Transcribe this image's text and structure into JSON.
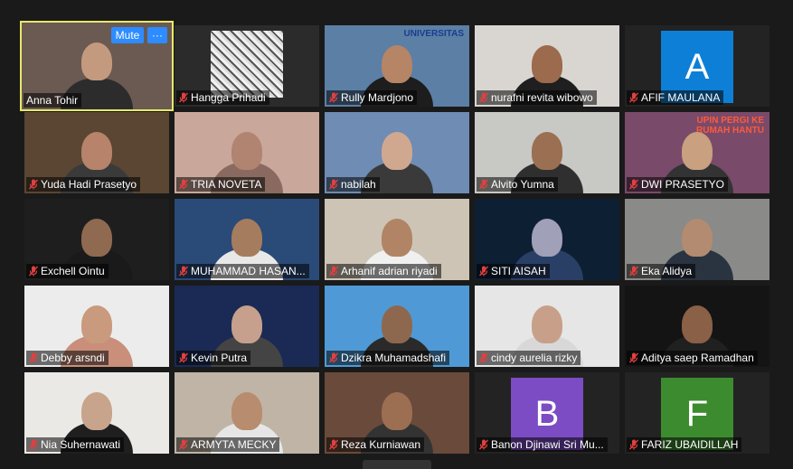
{
  "meeting": {
    "controls": {
      "mute_label": "Mute",
      "more_label": "···"
    },
    "participants": [
      {
        "name": "Anna Tohir",
        "muted": false,
        "active": true,
        "kind": "video",
        "bg": "#6b5a52",
        "skin": "#c49a7e",
        "cloth": "#2c2c2c"
      },
      {
        "name": "Hangga Prihadi",
        "muted": true,
        "kind": "image",
        "bg": "#2b2b2b",
        "picture": "#e8e8e8"
      },
      {
        "name": "Rully Mardjono",
        "muted": true,
        "kind": "video",
        "bg": "#5c7fa6",
        "skin": "#b58566",
        "cloth": "#1d1d1d",
        "banner": "UNIVERSITAS"
      },
      {
        "name": "nurafni revita wibowo",
        "muted": true,
        "kind": "video",
        "bg": "#d9d6d2",
        "skin": "#9c6a4d",
        "cloth": "#1f1f1f"
      },
      {
        "name": "AFIF MAULANA",
        "muted": true,
        "kind": "avatar",
        "letter": "A",
        "avatar_color": "#0e7fd6"
      },
      {
        "name": "Yuda Hadi Prasetyo",
        "muted": true,
        "kind": "video",
        "bg": "#5a4632",
        "skin": "#b7836a",
        "cloth": "#3a3a3a"
      },
      {
        "name": "TRIA NOVETA",
        "muted": true,
        "kind": "video",
        "bg": "#c9a79a",
        "skin": "#b08470",
        "cloth": "#8a6a60"
      },
      {
        "name": "nabilah",
        "muted": true,
        "kind": "video",
        "bg": "#6e8cb4",
        "skin": "#d0a890",
        "cloth": "#3a3a3a"
      },
      {
        "name": "Alvito Yumna",
        "muted": true,
        "kind": "video",
        "bg": "#c8c8c4",
        "skin": "#9b6f52",
        "cloth": "#2f2f2f"
      },
      {
        "name": "DWI PRASETYO",
        "muted": true,
        "kind": "video",
        "bg": "#7a4a6a",
        "skin": "#c9a080",
        "cloth": "#333",
        "banner": "UPIN PERGI KE RUMAH HANTU"
      },
      {
        "name": "Exchell Ointu",
        "muted": true,
        "kind": "video",
        "bg": "#1e1e1e",
        "skin": "#8f6a50",
        "cloth": "#1a1a1a"
      },
      {
        "name": "MUHAMMAD HASAN...",
        "muted": true,
        "kind": "video",
        "bg": "#2a4a78",
        "skin": "#a67c5e",
        "cloth": "#e8e8e8"
      },
      {
        "name": "Arhanif adrian riyadi",
        "muted": true,
        "kind": "video",
        "bg": "#cdc4b6",
        "skin": "#b08465",
        "cloth": "#f0f0f0"
      },
      {
        "name": "SITI AISAH",
        "muted": true,
        "kind": "video",
        "bg": "#0d1f33",
        "skin": "#a0a0b8",
        "cloth": "#2a3f66"
      },
      {
        "name": "Eka Alidya",
        "muted": true,
        "kind": "video",
        "bg": "#8a8a88",
        "skin": "#b28b70",
        "cloth": "#2a3340"
      },
      {
        "name": "Debby arsndi",
        "muted": true,
        "kind": "video",
        "bg": "#ececec",
        "skin": "#c99a7d",
        "cloth": "#c98f7a"
      },
      {
        "name": "Kevin Putra",
        "muted": true,
        "kind": "video",
        "bg": "#1a2a55",
        "skin": "#c6a08c",
        "cloth": "#444"
      },
      {
        "name": "Dzikra Muhamadshafi",
        "muted": true,
        "kind": "video",
        "bg": "#4f9ad6",
        "skin": "#8e684e",
        "cloth": "#2a2a2a"
      },
      {
        "name": "cindy aurelia rizky",
        "muted": true,
        "kind": "video",
        "bg": "#e6e6e6",
        "skin": "#c8a08a",
        "cloth": "#d8d8d8"
      },
      {
        "name": "Aditya saep Ramadhan",
        "muted": true,
        "kind": "video",
        "bg": "#141414",
        "skin": "#8a6046",
        "cloth": "#202020"
      },
      {
        "name": "Nia Suhernawati",
        "muted": true,
        "kind": "video",
        "bg": "#ebe9e6",
        "skin": "#c8a48c",
        "cloth": "#1f1f1f"
      },
      {
        "name": "ARMYTA MECKY",
        "muted": true,
        "kind": "video",
        "bg": "#bfb4a6",
        "skin": "#b88c6e",
        "cloth": "#e6e6e6"
      },
      {
        "name": "Reza Kurniawan",
        "muted": true,
        "kind": "video",
        "bg": "#6a4a3a",
        "skin": "#9c6e52",
        "cloth": "#333"
      },
      {
        "name": "Banon Djinawi Sri Mu...",
        "muted": true,
        "kind": "avatar",
        "letter": "B",
        "avatar_color": "#7b4cc4"
      },
      {
        "name": "FARIZ UBAIDILLAH",
        "muted": true,
        "kind": "avatar",
        "letter": "F",
        "avatar_color": "#3d8b2f"
      }
    ]
  }
}
